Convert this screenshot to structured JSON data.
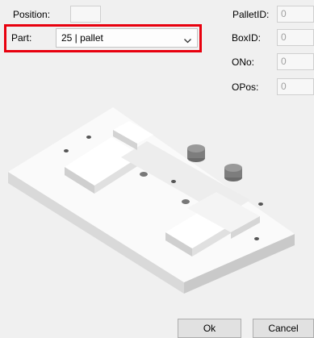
{
  "form": {
    "position_label": "Position:",
    "position_value": "",
    "part_label": "Part:",
    "part_value": "25 | pallet",
    "pallet_id_label": "PalletID:",
    "pallet_id_value": "0",
    "box_id_label": "BoxID:",
    "box_id_value": "0",
    "ono_label": "ONo:",
    "ono_value": "0",
    "opos_label": "OPos:",
    "opos_value": "0"
  },
  "buttons": {
    "ok_label": "Ok",
    "cancel_label": "Cancel"
  },
  "icons": {
    "dropdown": "chevron-down-icon"
  },
  "colors": {
    "highlight": "#e8000e",
    "window_bg": "#f0f0f0"
  }
}
